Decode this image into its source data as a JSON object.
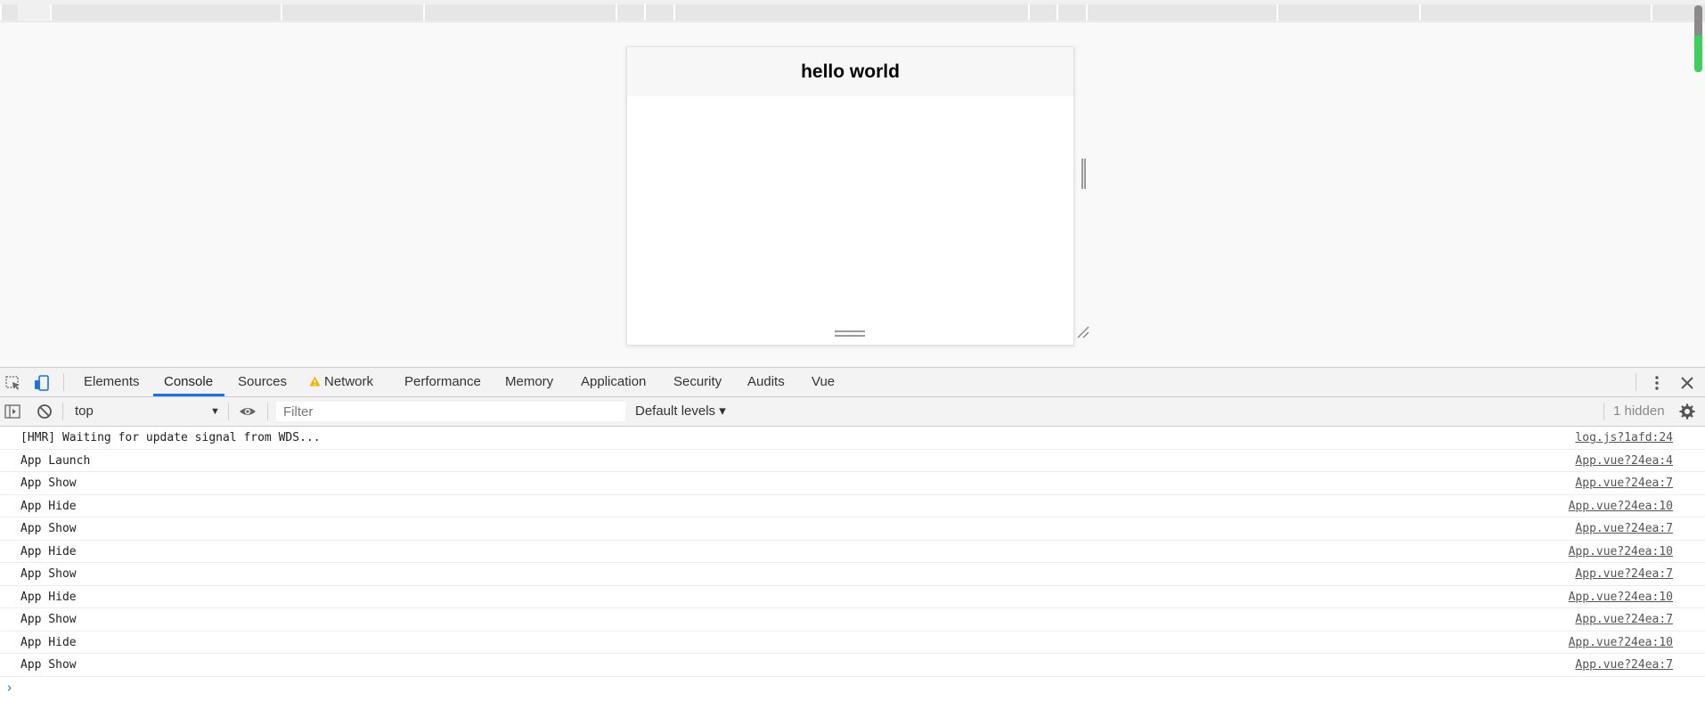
{
  "page": {
    "title": "hello world"
  },
  "devtools": {
    "tabs": [
      {
        "label": "Elements"
      },
      {
        "label": "Console"
      },
      {
        "label": "Sources"
      },
      {
        "label": "Network"
      },
      {
        "label": "Performance"
      },
      {
        "label": "Memory"
      },
      {
        "label": "Application"
      },
      {
        "label": "Security"
      },
      {
        "label": "Audits"
      },
      {
        "label": "Vue"
      }
    ],
    "active_tab": "Console",
    "console_toolbar": {
      "context": "top",
      "filter_placeholder": "Filter",
      "levels": "Default levels ▾",
      "hidden": "1 hidden"
    },
    "console_messages": [
      {
        "text": "[HMR] Waiting for update signal from WDS...",
        "source": "log.js?1afd:24"
      },
      {
        "text": "App Launch",
        "source": "App.vue?24ea:4"
      },
      {
        "text": "App Show",
        "source": "App.vue?24ea:7"
      },
      {
        "text": "App Hide",
        "source": "App.vue?24ea:10"
      },
      {
        "text": "App Show",
        "source": "App.vue?24ea:7"
      },
      {
        "text": "App Hide",
        "source": "App.vue?24ea:10"
      },
      {
        "text": "App Show",
        "source": "App.vue?24ea:7"
      },
      {
        "text": "App Hide",
        "source": "App.vue?24ea:10"
      },
      {
        "text": "App Show",
        "source": "App.vue?24ea:7"
      },
      {
        "text": "App Hide",
        "source": "App.vue?24ea:10"
      },
      {
        "text": "App Show",
        "source": "App.vue?24ea:7"
      }
    ],
    "prompt": "›"
  },
  "colors": {
    "accent": "#1a73e8",
    "warning": "#f2b600",
    "scroll_indicator": "#3ecf5c"
  }
}
